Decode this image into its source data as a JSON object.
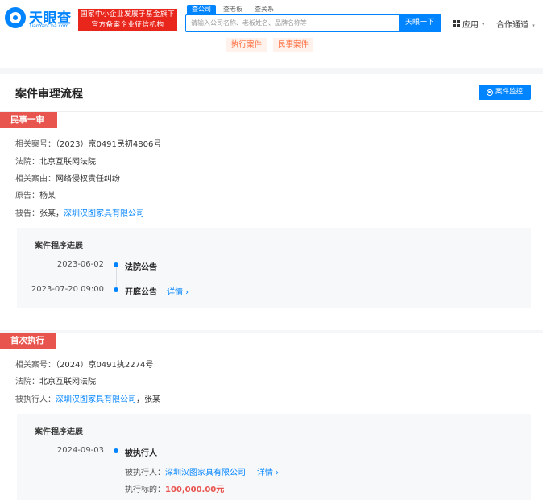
{
  "header": {
    "logo_text": "天眼查",
    "logo_domain": "TianYanCha.com",
    "official_line1": "国家中小企业发展子基金旗下",
    "official_line2": "官方备案企业征信机构",
    "search_tabs": [
      "查公司",
      "查老板",
      "查关系"
    ],
    "search_placeholder": "请输入公司名称、老板姓名、品牌名称等",
    "search_button": "天眼一下",
    "app_menu": "应用",
    "coop_menu": "合作通道"
  },
  "top_tags": [
    "执行案件",
    "民事案件"
  ],
  "main": {
    "title": "案件审理流程",
    "monitor_button": "案件监控",
    "sections": [
      {
        "label": "民事一审",
        "fields": [
          {
            "label": "相关案号：",
            "value": "（2023）京0491民初4806号"
          },
          {
            "label": "法院：",
            "value": "北京互联网法院"
          },
          {
            "label": "相关案由：",
            "value": "网络侵权责任纠纷"
          },
          {
            "label": "原告：",
            "value": "杨某"
          },
          {
            "label": "被告：",
            "value": "张某，",
            "link": "深圳汉图家具有限公司"
          }
        ],
        "progress_title": "案件程序进展",
        "events": [
          {
            "date": "2023-06-02",
            "event": "法院公告"
          },
          {
            "date": "2023-07-20 09:00",
            "event": "开庭公告",
            "detail": "详情 ›"
          }
        ]
      },
      {
        "label": "首次执行",
        "fields": [
          {
            "label": "相关案号：",
            "value": "（2024）京0491执2274号"
          },
          {
            "label": "法院：",
            "value": "北京互联网法院"
          },
          {
            "label": "被执行人：",
            "link": "深圳汉图家具有限公司",
            "value": "，张某"
          }
        ],
        "progress_title": "案件程序进展",
        "events": [
          {
            "date": "2024-09-03",
            "event": "被执行人",
            "sub_executed_label": "被执行人：",
            "sub_executed_link": "深圳汉图家具有限公司",
            "detail": "详情 ›",
            "sub_amount_label": "执行标的：",
            "sub_amount_value": "100,000.00元"
          }
        ]
      }
    ]
  },
  "colors": {
    "brand_blue": "#0084ff",
    "section_red": "#e8554e",
    "official_red": "#e9261c",
    "tag_orange": "#ff6b3d"
  }
}
